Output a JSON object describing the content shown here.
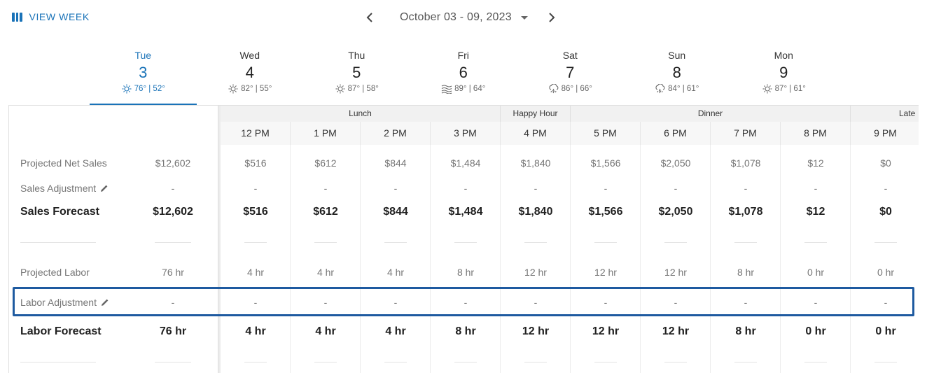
{
  "header": {
    "view_week_label": "VIEW WEEK",
    "date_range": "October 03 - 09, 2023"
  },
  "days": [
    {
      "name": "Tue",
      "num": "3",
      "weather": "76° | 52°",
      "icon": "sun-icon",
      "active": true
    },
    {
      "name": "Wed",
      "num": "4",
      "weather": "82° | 55°",
      "icon": "sun-icon"
    },
    {
      "name": "Thu",
      "num": "5",
      "weather": "87° | 58°",
      "icon": "sun-icon"
    },
    {
      "name": "Fri",
      "num": "6",
      "weather": "89° | 64°",
      "icon": "wind-icon"
    },
    {
      "name": "Sat",
      "num": "7",
      "weather": "86° | 66°",
      "icon": "thunderstorm-icon"
    },
    {
      "name": "Sun",
      "num": "8",
      "weather": "84° | 61°",
      "icon": "thunderstorm-icon"
    },
    {
      "name": "Mon",
      "num": "9",
      "weather": "87° | 61°",
      "icon": "sun-icon"
    }
  ],
  "periods": [
    {
      "label": "Lunch"
    },
    {
      "label": "Happy Hour"
    },
    {
      "label": "Dinner"
    },
    {
      "label": "Late"
    }
  ],
  "hours": [
    "12 PM",
    "1 PM",
    "2 PM",
    "3 PM",
    "4 PM",
    "5 PM",
    "6 PM",
    "7 PM",
    "8 PM",
    "9 PM"
  ],
  "rows": {
    "projected_net_sales": {
      "label": "Projected Net Sales",
      "total": "$12,602",
      "values": [
        "$516",
        "$612",
        "$844",
        "$1,484",
        "$1,840",
        "$1,566",
        "$2,050",
        "$1,078",
        "$12",
        "$0"
      ]
    },
    "sales_adjustment": {
      "label": "Sales Adjustment",
      "total": "-",
      "values": [
        "-",
        "-",
        "-",
        "-",
        "-",
        "-",
        "-",
        "-",
        "-",
        "-"
      ]
    },
    "sales_forecast": {
      "label": "Sales Forecast",
      "total": "$12,602",
      "values": [
        "$516",
        "$612",
        "$844",
        "$1,484",
        "$1,840",
        "$1,566",
        "$2,050",
        "$1,078",
        "$12",
        "$0"
      ]
    },
    "projected_labor": {
      "label": "Projected Labor",
      "total": "76 hr",
      "values": [
        "4 hr",
        "4 hr",
        "4 hr",
        "8 hr",
        "12 hr",
        "12 hr",
        "12 hr",
        "8 hr",
        "0 hr",
        "0 hr"
      ]
    },
    "labor_adjustment": {
      "label": "Labor Adjustment",
      "total": "-",
      "values": [
        "-",
        "-",
        "-",
        "-",
        "-",
        "-",
        "-",
        "-",
        "-",
        "-"
      ]
    },
    "labor_forecast": {
      "label": "Labor Forecast",
      "total": "76 hr",
      "values": [
        "4 hr",
        "4 hr",
        "4 hr",
        "8 hr",
        "12 hr",
        "12 hr",
        "12 hr",
        "8 hr",
        "0 hr",
        "0 hr"
      ]
    }
  },
  "colors": {
    "accent": "#1a73b8",
    "highlight": "#1e5aa0"
  }
}
